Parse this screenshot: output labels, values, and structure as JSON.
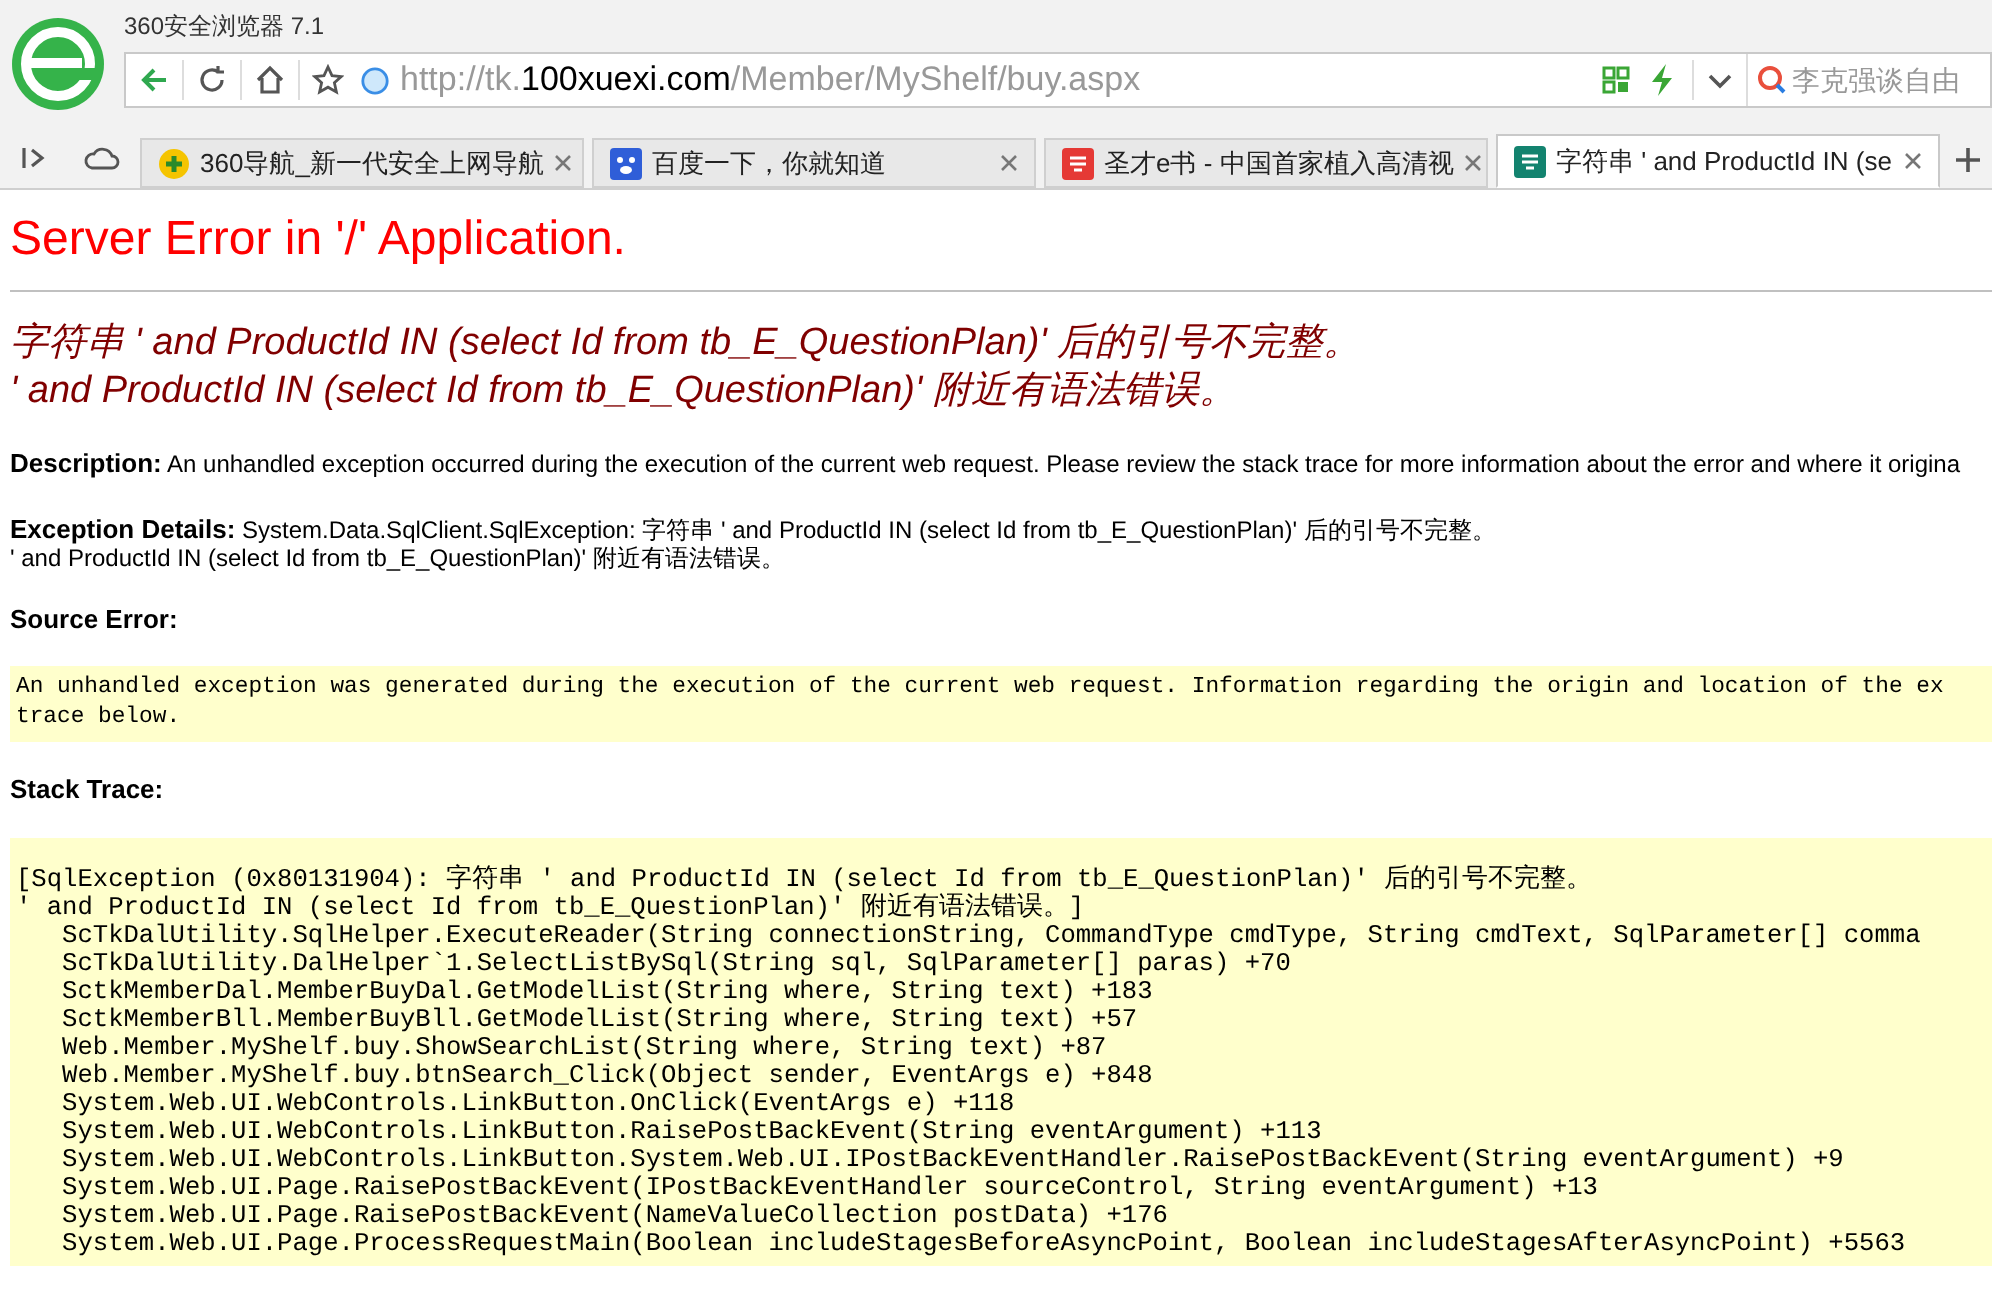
{
  "browser": {
    "title": "360安全浏览器 7.1",
    "address": {
      "prefix": "http://tk.",
      "domain": "100xuexi.com",
      "path": "/Member/MyShelf/buy.aspx"
    },
    "search_text": "李克强谈自由",
    "tabs": [
      {
        "label": "360导航_新一代安全上网导航",
        "selected": false
      },
      {
        "label": "百度一下，你就知道",
        "selected": false
      },
      {
        "label": "圣才e书 - 中国首家植入高清视",
        "selected": false
      },
      {
        "label": "字符串 ' and ProductId IN (se",
        "selected": true
      }
    ]
  },
  "page": {
    "title": "Server Error in '/' Application.",
    "error_message": [
      "字符串 ' and ProductId IN (select Id from tb_E_QuestionPlan)' 后的引号不完整。",
      "' and ProductId IN (select Id from tb_E_QuestionPlan)' 附近有语法错误。"
    ],
    "description": {
      "label": "Description:",
      "text": "An unhandled exception occurred during the execution of the current web request. Please review the stack trace for more information about the error and where it origina"
    },
    "exception_details": {
      "label": "Exception Details:",
      "lines": [
        "System.Data.SqlClient.SqlException: 字符串 ' and ProductId IN (select Id from tb_E_QuestionPlan)' 后的引号不完整。",
        "' and ProductId IN (select Id from tb_E_QuestionPlan)' 附近有语法错误。"
      ]
    },
    "source_error": {
      "label": "Source Error:",
      "lines": [
        "An unhandled exception was generated during the execution of the current web request. Information regarding the origin and location of the ex",
        "trace below."
      ]
    },
    "stack_trace": {
      "label": "Stack Trace:",
      "lines": [
        "[SqlException (0x80131904): 字符串 ' and ProductId IN (select Id from tb_E_QuestionPlan)' 后的引号不完整。",
        "' and ProductId IN (select Id from tb_E_QuestionPlan)' 附近有语法错误。]",
        "   ScTkDalUtility.SqlHelper.ExecuteReader(String connectionString, CommandType cmdType, String cmdText, SqlParameter[] comma",
        "   ScTkDalUtility.DalHelper`1.SelectListBySql(String sql, SqlParameter[] paras) +70",
        "   SctkMemberDal.MemberBuyDal.GetModelList(String where, String text) +183",
        "   SctkMemberBll.MemberBuyBll.GetModelList(String where, String text) +57",
        "   Web.Member.MyShelf.buy.ShowSearchList(String where, String text) +87",
        "   Web.Member.MyShelf.buy.btnSearch_Click(Object sender, EventArgs e) +848",
        "   System.Web.UI.WebControls.LinkButton.OnClick(EventArgs e) +118",
        "   System.Web.UI.WebControls.LinkButton.RaisePostBackEvent(String eventArgument) +113",
        "   System.Web.UI.WebControls.LinkButton.System.Web.UI.IPostBackEventHandler.RaisePostBackEvent(String eventArgument) +9",
        "   System.Web.UI.Page.RaisePostBackEvent(IPostBackEventHandler sourceControl, String eventArgument) +13",
        "   System.Web.UI.Page.RaisePostBackEvent(NameValueCollection postData) +176",
        "   System.Web.UI.Page.ProcessRequestMain(Boolean includeStagesBeforeAsyncPoint, Boolean includeStagesAfterAsyncPoint) +5563"
      ]
    }
  }
}
